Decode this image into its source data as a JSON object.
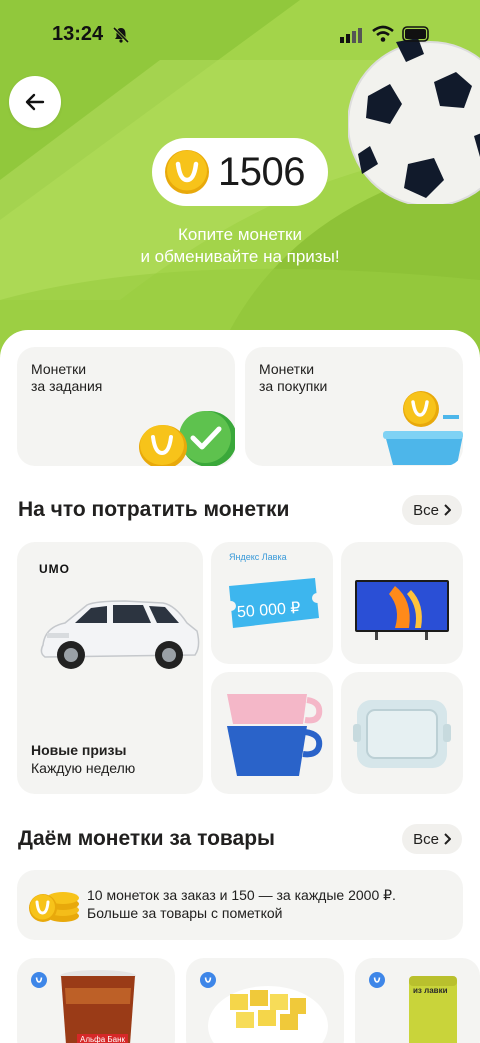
{
  "status_bar": {
    "time": "13:24"
  },
  "balance": {
    "coins": "1506"
  },
  "hero": {
    "subtitle_line1": "Копите монетки",
    "subtitle_line2": "и обменивайте на призы!"
  },
  "earn_cards": [
    {
      "line1": "Монетки",
      "line2": "за задания"
    },
    {
      "line1": "Монетки",
      "line2": "за покупки"
    }
  ],
  "spend_section": {
    "title": "На что потратить монетки",
    "all_label": "Все",
    "big_card": {
      "brand": "UMO",
      "title": "Новые призы",
      "subtitle": "Каждую неделю"
    },
    "certificate": {
      "brand": "Яндекс Лавка",
      "amount": "50 000 ₽"
    }
  },
  "goods_section": {
    "title": "Даём монетки за товары",
    "all_label": "Все",
    "info_line1": "10 монеток за заказ и 150 — за каждые 2000 ₽.",
    "info_line2": "Больше за товары с пометкой"
  },
  "products": [
    {
      "label": "Альфа Банк"
    },
    {
      "label": ""
    },
    {
      "label": "из лавки"
    }
  ],
  "colors": {
    "hero_green": "#a3d44a",
    "coin_yellow": "#f7c31a",
    "accent_blue": "#3e86e8"
  }
}
